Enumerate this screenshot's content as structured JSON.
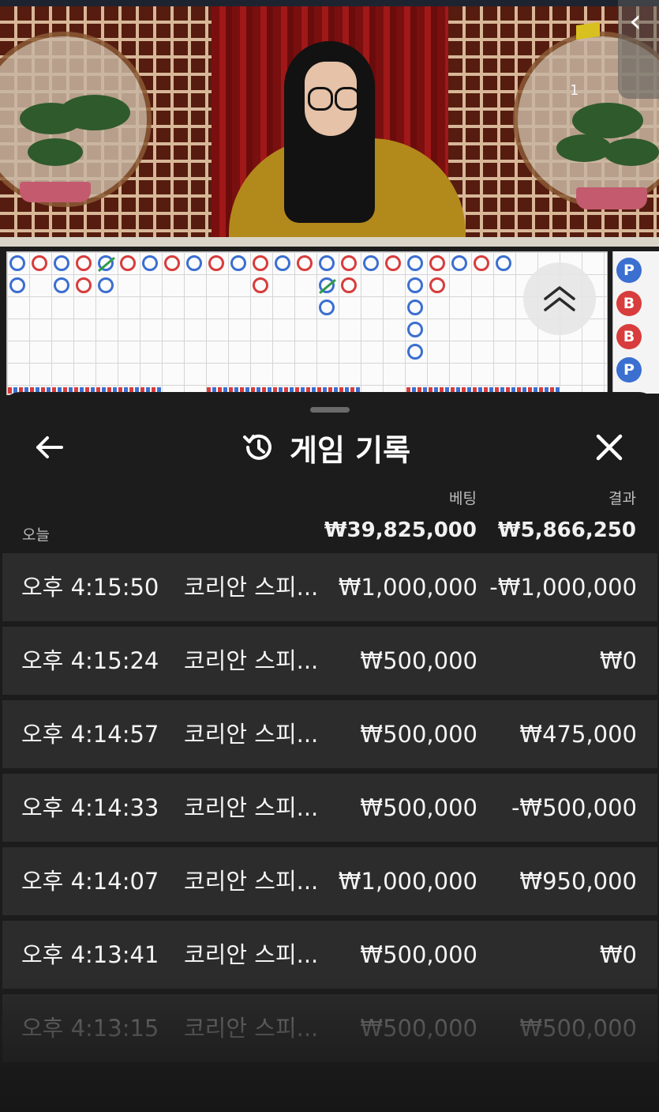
{
  "video": {
    "score_label": "1",
    "side_tab_glyph": "‹"
  },
  "road": {
    "side_badges": [
      "P",
      "B",
      "B",
      "P"
    ]
  },
  "sheet": {
    "title": "게임 기록",
    "icons": {
      "back": "arrow-left-icon",
      "history": "history-icon",
      "close": "close-icon",
      "expand": "chevron-double-up-icon"
    },
    "columns": {
      "bet": "베팅",
      "result": "결과"
    },
    "summary": {
      "label": "오늘",
      "bet_total": "₩39,825,000",
      "result_total": "₩5,866,250"
    },
    "rows": [
      {
        "time": "오후 4:15:50",
        "game": "코리안 스피...",
        "bet": "₩1,000,000",
        "result": "-₩1,000,000"
      },
      {
        "time": "오후 4:15:24",
        "game": "코리안 스피...",
        "bet": "₩500,000",
        "result": "₩0"
      },
      {
        "time": "오후 4:14:57",
        "game": "코리안 스피...",
        "bet": "₩500,000",
        "result": "₩475,000"
      },
      {
        "time": "오후 4:14:33",
        "game": "코리안 스피...",
        "bet": "₩500,000",
        "result": "-₩500,000"
      },
      {
        "time": "오후 4:14:07",
        "game": "코리안 스피...",
        "bet": "₩1,000,000",
        "result": "₩950,000"
      },
      {
        "time": "오후 4:13:41",
        "game": "코리안 스피...",
        "bet": "₩500,000",
        "result": "₩0"
      },
      {
        "time": "오후 4:13:15",
        "game": "코리안 스피...",
        "bet": "₩500,000",
        "result": "₩500,000"
      }
    ]
  }
}
